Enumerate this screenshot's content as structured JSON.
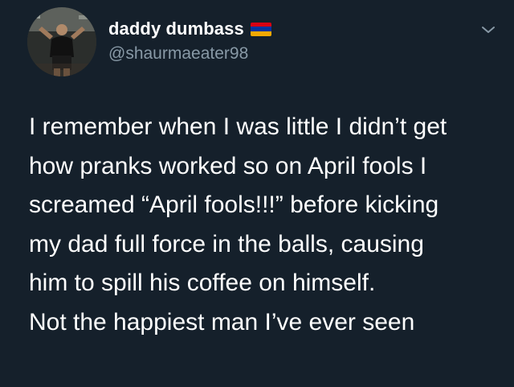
{
  "tweet": {
    "author": {
      "display_name": "daddy dumbass",
      "handle": "@shaurmaeater98",
      "flag_icon": "armenia-flag-icon",
      "flag_colors": [
        "#d90012",
        "#0033a0",
        "#f2a800"
      ]
    },
    "menu_icon": "chevron-down-icon",
    "text_lines": [
      "I remember when I was little I didn’t get",
      "how pranks worked so on April fools I",
      "screamed “April fools!!!” before kicking",
      "my dad full force in the balls, causing",
      "him to spill his coffee on himself.",
      "Not the happiest man I’ve ever seen"
    ]
  },
  "theme": {
    "background": "#15202b",
    "text": "#ffffff",
    "secondary_text": "#8899a6"
  }
}
